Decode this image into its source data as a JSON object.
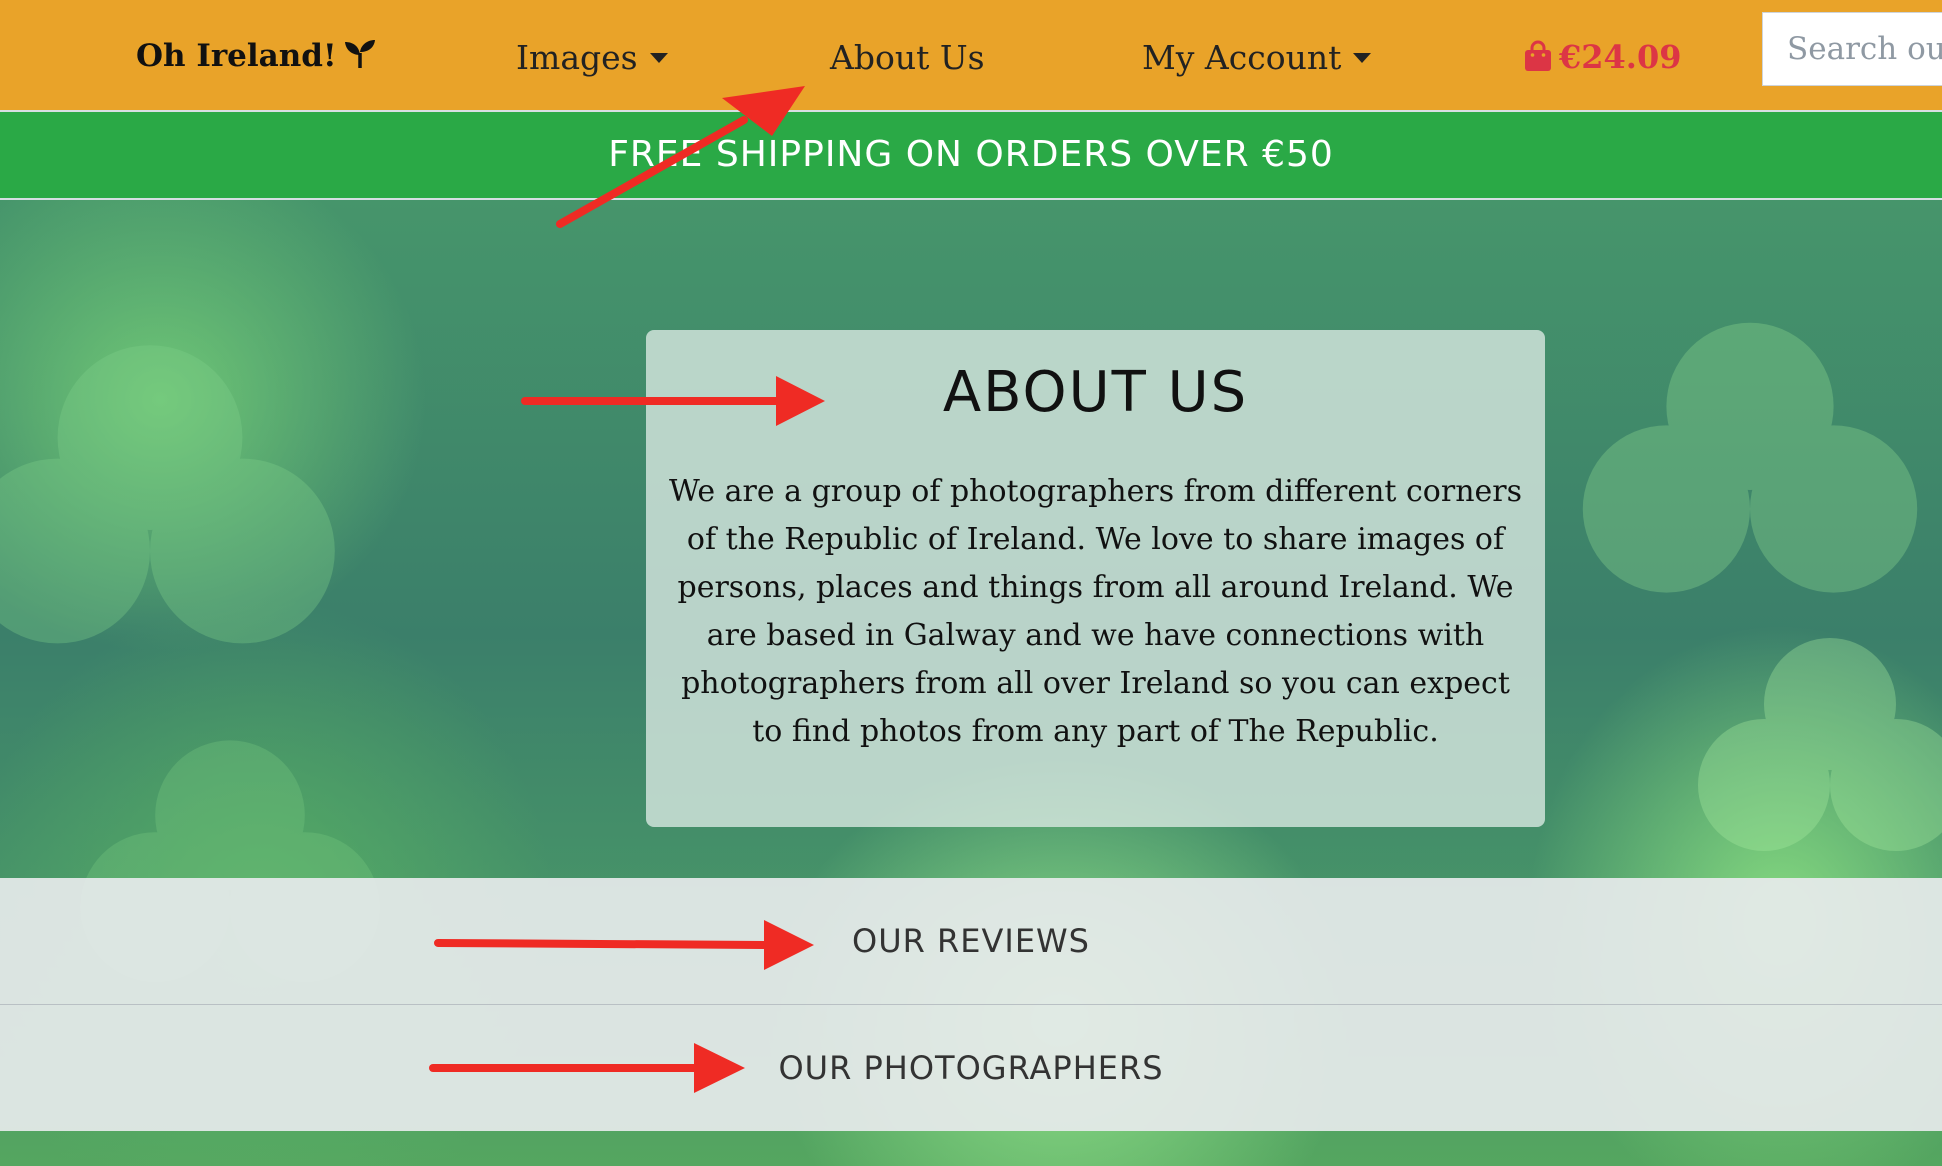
{
  "navbar": {
    "brand": "Oh Ireland!",
    "brand_icon": "seedling-icon",
    "links": {
      "images": "Images",
      "about": "About Us",
      "account": "My Account"
    },
    "cart_total": "€24.09",
    "search_placeholder": "Search our site",
    "colors": {
      "background": "#e9a329",
      "cart": "#dc3545"
    }
  },
  "banner": {
    "text": "FREE SHIPPING ON ORDERS OVER €50",
    "color": "#2aa946"
  },
  "about": {
    "title": "ABOUT US",
    "body": "We are a group of photographers from different corners of the Republic of Ireland. We love to share images of persons, places and things from all around Ireland. We are based in Galway and we have connections with photographers from all over Ireland so you can expect to find photos from any part of The Republic."
  },
  "sections": {
    "reviews": "OUR REVIEWS",
    "photographers": "OUR PHOTOGRAPHERS"
  },
  "annotations": {
    "arrow_color": "#ef2b24"
  }
}
